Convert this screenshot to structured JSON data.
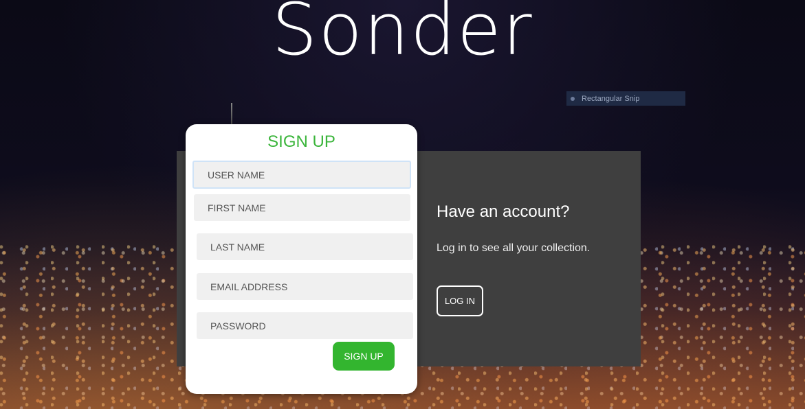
{
  "brand": {
    "title": "Sonder"
  },
  "snip_toolbar": {
    "label": "Rectangular Snip"
  },
  "signup_form": {
    "heading": "SIGN UP",
    "fields": [
      {
        "placeholder": "USER NAME"
      },
      {
        "placeholder": "FIRST NAME"
      },
      {
        "placeholder": "LAST NAME"
      },
      {
        "placeholder": "EMAIL ADDRESS"
      },
      {
        "placeholder": "PASSWORD"
      }
    ],
    "submit_label": "SIGN UP"
  },
  "login_panel": {
    "heading": "Have an account?",
    "text": "Log in to see all your collection.",
    "button_label": "LOG IN"
  },
  "colors": {
    "accent_green": "#33b52f",
    "panel_gray": "#3f3f3f"
  }
}
